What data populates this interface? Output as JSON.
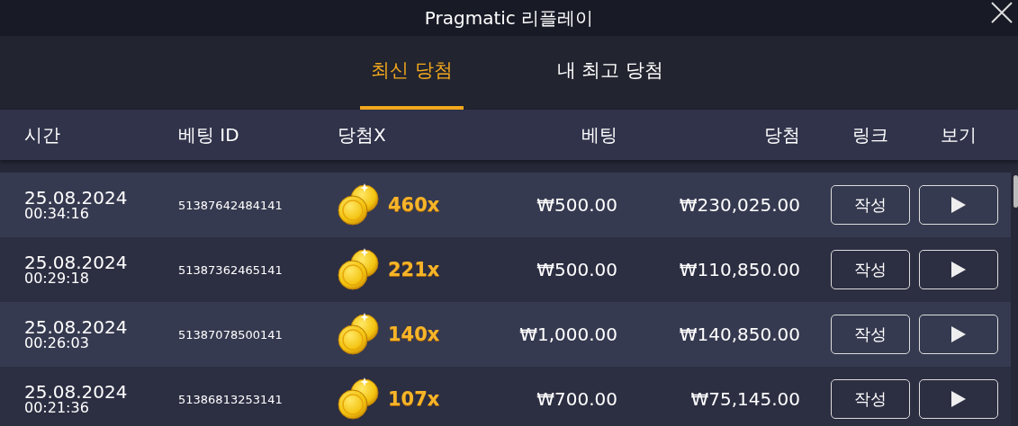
{
  "window": {
    "title": "Pragmatic 리플레이"
  },
  "tabs": [
    {
      "label": "최신 당첨",
      "selected": true
    },
    {
      "label": "내 최고 당첨",
      "selected": false
    }
  ],
  "table": {
    "columns": [
      "시간",
      "베팅 ID",
      "당첨X",
      "베팅",
      "당첨",
      "링크",
      "보기"
    ],
    "rows": [
      {
        "date": "25.08.2024",
        "time": "00:34:16",
        "bet_id": "51387642484141",
        "multiplier": "460x",
        "bet": "₩500.00",
        "win": "₩230,025.00",
        "link_button": "작성"
      },
      {
        "date": "25.08.2024",
        "time": "00:29:18",
        "bet_id": "51387362465141",
        "multiplier": "221x",
        "bet": "₩500.00",
        "win": "₩110,850.00",
        "link_button": "작성"
      },
      {
        "date": "25.08.2024",
        "time": "00:26:03",
        "bet_id": "51387078500141",
        "multiplier": "140x",
        "bet": "₩1,000.00",
        "win": "₩140,850.00",
        "link_button": "작성"
      },
      {
        "date": "25.08.2024",
        "time": "00:21:36",
        "bet_id": "51386813253141",
        "multiplier": "107x",
        "bet": "₩700.00",
        "win": "₩75,145.00",
        "link_button": "작성"
      }
    ]
  }
}
